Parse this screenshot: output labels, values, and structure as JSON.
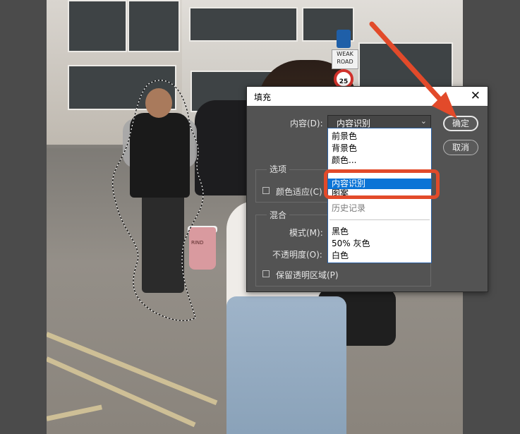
{
  "dialog": {
    "title": "填充",
    "content_label": "内容(D):",
    "content_value": "内容识别",
    "options_group_title": "选项",
    "color_adapt_label": "颜色适应(C)",
    "blend_group_title": "混合",
    "mode_label": "模式(M):",
    "opacity_label": "不透明度(O):",
    "preserve_transparency_label": "保留透明区域(P)",
    "ok_button": "确定",
    "cancel_button": "取消"
  },
  "dropdown": {
    "items": [
      "前景色",
      "背景色",
      "颜色...",
      "内容识别",
      "图案",
      "历史记录",
      "黑色",
      "50% 灰色",
      "白色"
    ],
    "selected": "内容识别"
  },
  "photo": {
    "sign_text": "WEAK ROAD",
    "speed_limit": "25",
    "cup_text": "RIND"
  },
  "annotation": {
    "color": "#e24a2a"
  }
}
